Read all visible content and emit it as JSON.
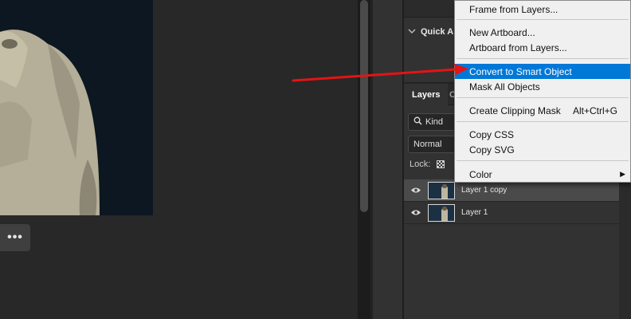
{
  "canvas": {
    "more_button_label": "•••"
  },
  "panel": {
    "quick_actions_label": "Quick A",
    "tabs": [
      {
        "label": "Layers"
      },
      {
        "label": "C"
      }
    ],
    "filter_kind_label": "Kind",
    "blend_mode_value": "Normal",
    "lock_label": "Lock:"
  },
  "layers": [
    {
      "name": "Layer 1 copy",
      "selected": true
    },
    {
      "name": "Layer 1",
      "selected": false
    }
  ],
  "context_menu": {
    "items": [
      {
        "label": "Frame from Layers..."
      },
      {
        "label": "New Artboard..."
      },
      {
        "label": "Artboard from Layers..."
      },
      {
        "label": "Convert to Smart Object",
        "highlighted": true
      },
      {
        "label": "Mask All Objects"
      },
      {
        "label": "Create Clipping Mask",
        "shortcut": "Alt+Ctrl+G"
      },
      {
        "label": "Copy CSS"
      },
      {
        "label": "Copy SVG"
      },
      {
        "label": "Color",
        "submenu_icon": "triangle-right-icon"
      }
    ]
  },
  "colors": {
    "menu_highlight": "#0078d7",
    "annotation_arrow": "#e41414",
    "canvas_bg": "#282828",
    "panel_bg": "#323232"
  }
}
